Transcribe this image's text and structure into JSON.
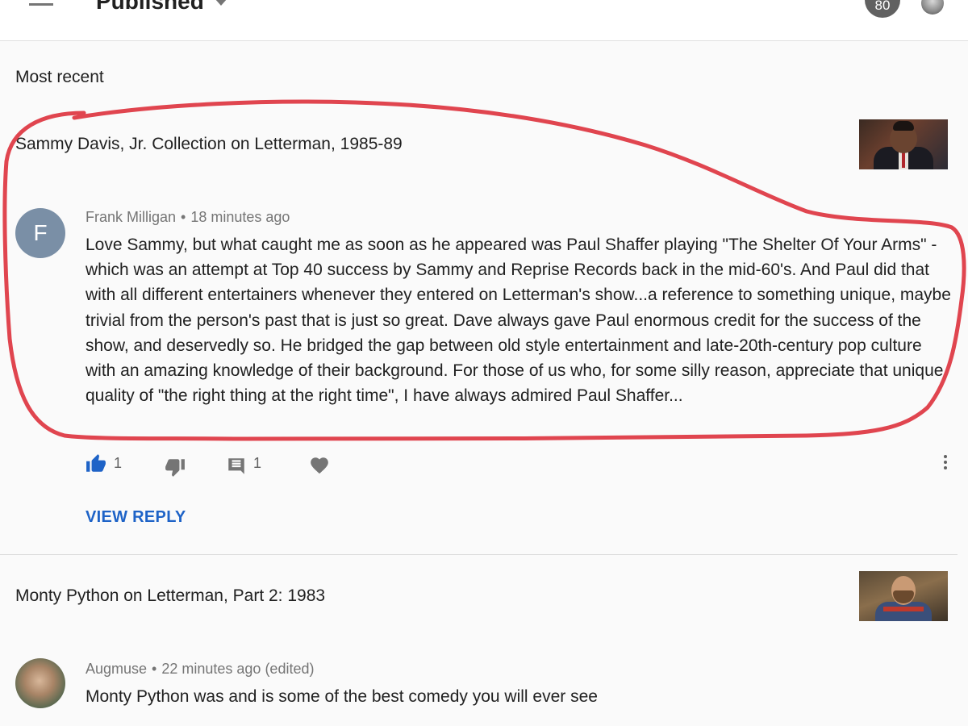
{
  "header": {
    "filter_label": "Published",
    "notification_count": "80"
  },
  "section_heading": "Most recent",
  "items": [
    {
      "video_title": "Sammy Davis, Jr. Collection on Letterman, 1985-89",
      "comment": {
        "avatar_letter": "F",
        "author": "Frank Milligan",
        "separator": "•",
        "time": "18 minutes ago",
        "text": "Love Sammy, but what caught me as soon as he appeared was Paul Shaffer playing \"The Shelter Of Your Arms\" - which was an attempt at Top 40 success by Sammy and Reprise Records back in the mid-60's. And Paul did that with all different entertainers whenever they entered on Letterman's show...a reference to something unique, maybe trivial from the person's past that is just so great. Dave always gave Paul enormous credit for the success of the show, and deservedly so.  He bridged the gap between old style entertainment and late-20th-century pop culture with an amazing knowledge of their background. For those of us who, for some silly reason, appreciate that unique quality of \"the right thing at the right time\", I have always admired Paul Shaffer...",
        "like_count": "1",
        "reply_count": "1",
        "view_reply_label": "VIEW REPLY"
      }
    },
    {
      "video_title": "Monty Python on Letterman, Part 2: 1983",
      "comment": {
        "author": "Augmuse",
        "separator": "•",
        "time": "22 minutes ago (edited)",
        "text": "Monty Python was and is some of the best comedy you will ever see"
      }
    }
  ],
  "colors": {
    "accent_blue": "#1e63c7",
    "annotation_red": "#e0454f",
    "avatar_f": "#7a8fa6"
  },
  "icons": [
    "menu-icon",
    "dropdown-caret-icon",
    "thumbs-up-icon",
    "thumbs-down-icon",
    "reply-icon",
    "heart-icon",
    "more-vert-icon"
  ]
}
